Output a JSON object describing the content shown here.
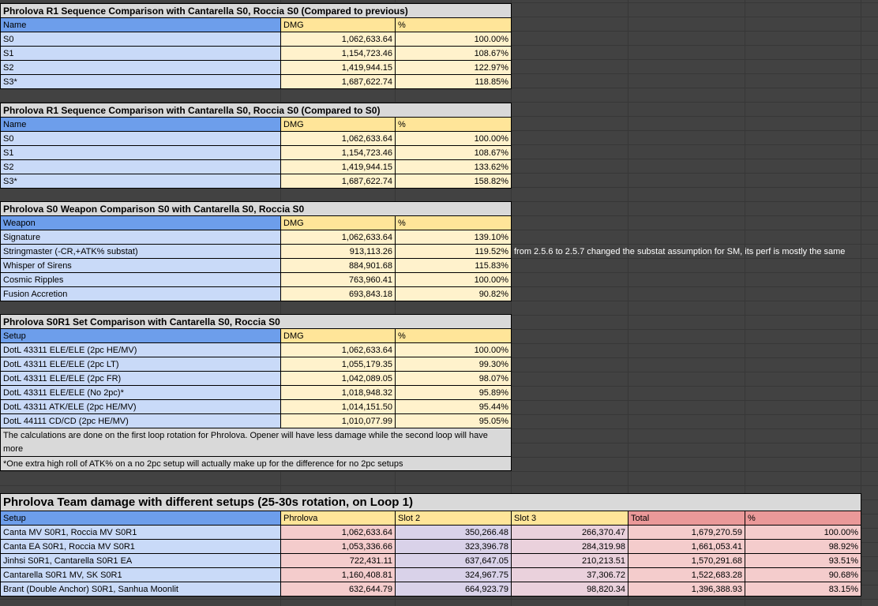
{
  "colors": {
    "bg": "#424242",
    "grid-line": "#373737",
    "title-gray": "#d9d9d9",
    "header-blue": "#6d9eeb",
    "data-blue": "#c9daf8",
    "header-yellow": "#ffe599",
    "data-cream": "#fff2cc",
    "header-red": "#ea9999",
    "data-pink": "#f4cccc",
    "data-lavender": "#d9d2e9",
    "data-magenta": "#ead1dc",
    "cell-border": "#000000",
    "note-text": "#ffffff"
  },
  "tables": {
    "t1": {
      "title": "Phrolova R1 Sequence Comparison with Cantarella S0, Roccia S0 (Compared to previous)",
      "headers": [
        "Name",
        "DMG",
        "%"
      ],
      "rows": [
        [
          "S0",
          "1,062,633.64",
          "100.00%"
        ],
        [
          "S1",
          "1,154,723.46",
          "108.67%"
        ],
        [
          "S2",
          "1,419,944.15",
          "122.97%"
        ],
        [
          "S3*",
          "1,687,622.74",
          "118.85%"
        ]
      ]
    },
    "t2": {
      "title": "Phrolova R1 Sequence Comparison with Cantarella S0, Roccia S0 (Compared to S0)",
      "headers": [
        "Name",
        "DMG",
        "%"
      ],
      "rows": [
        [
          "S0",
          "1,062,633.64",
          "100.00%"
        ],
        [
          "S1",
          "1,154,723.46",
          "108.67%"
        ],
        [
          "S2",
          "1,419,944.15",
          "133.62%"
        ],
        [
          "S3*",
          "1,687,622.74",
          "158.82%"
        ]
      ]
    },
    "t3": {
      "title": "Phrolova S0 Weapon Comparison S0 with Cantarella S0, Roccia S0",
      "headers": [
        "Weapon",
        "DMG",
        "%"
      ],
      "rows": [
        [
          "Signature",
          "1,062,633.64",
          "139.10%"
        ],
        [
          "Stringmaster (-CR,+ATK% substat)",
          "913,113.26",
          "119.52%"
        ],
        [
          "Whisper of Sirens",
          "884,901.68",
          "115.83%"
        ],
        [
          "Cosmic Ripples",
          "763,960.41",
          "100.00%"
        ],
        [
          "Fusion Accretion",
          "693,843.18",
          "90.82%"
        ]
      ],
      "side_note": "from 2.5.6 to 2.5.7 changed the substat assumption for SM, its perf is mostly the same"
    },
    "t4": {
      "title": "Phrolova S0R1 Set Comparison with Cantarella S0, Roccia S0",
      "headers": [
        "Setup",
        "DMG",
        "%"
      ],
      "rows": [
        [
          "DotL 43311 ELE/ELE (2pc HE/MV)",
          "1,062,633.64",
          "100.00%"
        ],
        [
          "DotL 43311 ELE/ELE (2pc LT)",
          "1,055,179.35",
          "99.30%"
        ],
        [
          "DotL 43311 ELE/ELE (2pc FR)",
          "1,042,089.05",
          "98.07%"
        ],
        [
          "DotL 43311 ELE/ELE (No 2pc)*",
          "1,018,948.32",
          "95.89%"
        ],
        [
          "DotL 43311 ATK/ELE (2pc HE/MV)",
          "1,014,151.50",
          "95.44%"
        ],
        [
          "DotL 44111 CD/CD (2pc HE/MV)",
          "1,010,077.99",
          "95.05%"
        ]
      ],
      "note1": "The calculations are done on the first loop rotation for Phrolova. Opener will have less damage while the second loop will have more",
      "note2": "*One extra high roll of ATK% on a no 2pc setup will actually make up for the difference for no 2pc setups"
    },
    "team": {
      "title": "Phrolova Team damage with different setups (25-30s rotation, on Loop 1)",
      "headers": [
        "Setup",
        "Phrolova",
        "Slot 2",
        "Slot 3",
        "Total",
        "%"
      ],
      "rows": [
        [
          "Canta MV S0R1, Roccia MV S0R1",
          "1,062,633.64",
          "350,266.48",
          "266,370.47",
          "1,679,270.59",
          "100.00%"
        ],
        [
          "Canta EA S0R1, Roccia MV S0R1",
          "1,053,336.66",
          "323,396.78",
          "284,319.98",
          "1,661,053.41",
          "98.92%"
        ],
        [
          "Jinhsi S0R1, Cantarella S0R1 EA",
          "722,431.11",
          "637,647.05",
          "210,213.51",
          "1,570,291.68",
          "93.51%"
        ],
        [
          "Cantarella S0R1 MV, SK S0R1",
          "1,160,408.81",
          "324,967.75",
          "37,306.72",
          "1,522,683.28",
          "90.68%"
        ],
        [
          "Brant (Double Anchor) S0R1, Sanhua Moonlit",
          "632,644.79",
          "664,923.79",
          "98,820.34",
          "1,396,388.93",
          "83.15%"
        ]
      ]
    }
  }
}
